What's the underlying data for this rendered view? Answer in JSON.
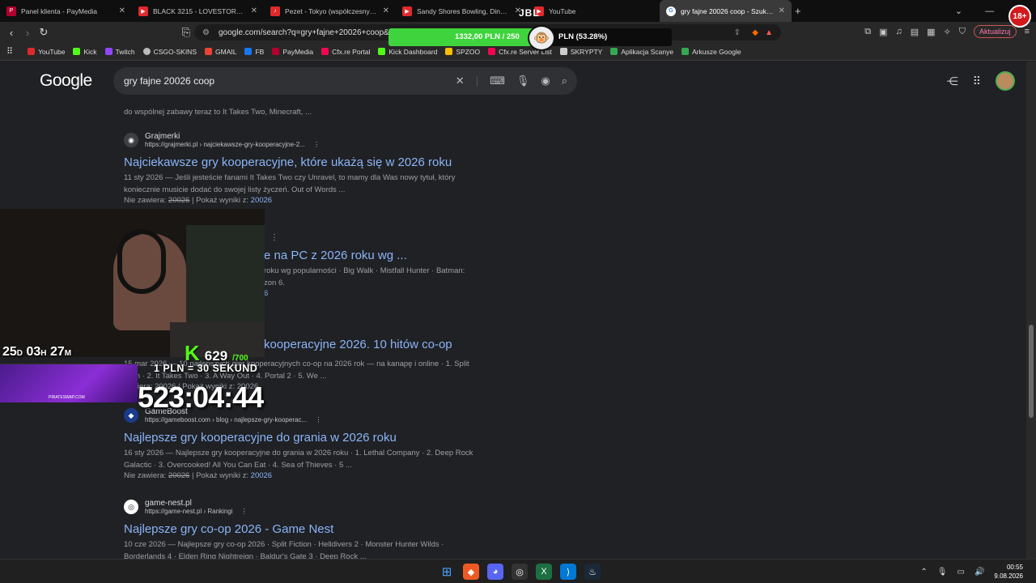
{
  "tabs": [
    {
      "label": "Panel klienta - PayMedia",
      "icon": "paymedia-icon"
    },
    {
      "label": "BLACK 3215 - LOVESTORY - YouTube",
      "icon": "youtube-icon"
    },
    {
      "label": "Pezet - Tokyo (współczesny) (pro",
      "icon": "speaker-icon"
    },
    {
      "label": "Sandy Shores Bowling, Diner & Ste",
      "icon": "youtube-icon"
    },
    {
      "label": "YouTube",
      "icon": "youtube-icon"
    },
    {
      "label": "gry fajne 20026 coop - Szukaj w",
      "icon": "google-icon"
    }
  ],
  "overlay": {
    "jbl": "JBL",
    "donation_text": "1332,00 PLN / 250",
    "donation_text_right": "PLN (53.28%)",
    "donation_percent": 53.28,
    "age_badge": "18+",
    "webcam_timer_days": "25",
    "webcam_timer_hours": "03",
    "webcam_timer_minutes": "27",
    "kick_count": "629",
    "kick_goal": "/700",
    "pln_rate": "1 PLN = 30 SEKUND",
    "big_timer": "523:04:44",
    "purple_caption": "PIRATESWAP.COM"
  },
  "toolbar": {
    "url": "google.com/search?q=gry+fajne+20026+coop&sca_esv=...0tUbHQhPi9o8aQsceEk6Q%3A1786229688127...",
    "update_label": "Aktualizuj"
  },
  "bookmarks": [
    {
      "label": "YouTube",
      "color": "#e0292d"
    },
    {
      "label": "Kick",
      "color": "#53fc18"
    },
    {
      "label": "Twitch",
      "color": "#9146ff"
    },
    {
      "label": "CSGO-SKINS",
      "color": "#bbbbbb"
    },
    {
      "label": "GMAIL",
      "color": "#ea4335"
    },
    {
      "label": "FB",
      "color": "#1877f2"
    },
    {
      "label": "PayMedia",
      "color": "#b3002d"
    },
    {
      "label": "Cfx.re Portal",
      "color": "#f40552"
    },
    {
      "label": "Kick Dashboard",
      "color": "#53fc18"
    },
    {
      "label": "SPZOO",
      "color": "#fbbc04"
    },
    {
      "label": "Cfx.re Server List",
      "color": "#f40552"
    },
    {
      "label": "SKRYPTY",
      "color": "#cccccc"
    },
    {
      "label": "Aplikacja Scanye",
      "color": "#34a853"
    },
    {
      "label": "Arkusze Google",
      "color": "#34a853"
    }
  ],
  "search": {
    "logo": "Google",
    "query": "gry fajne 20026 coop"
  },
  "partial_snippet": "do wspólnej zabawy teraz to It Takes Two, Minecraft, ...",
  "results": [
    {
      "site": "Grajmerki",
      "url": "https://grajmerki.pl › najciekawsze-gry-kooperacyjne-2...",
      "title": "Najciekawsze gry kooperacyjne, które ukażą się w 2026 roku",
      "snippet": "11 sty 2026 — Jeśli jesteście fanami It Takes Two czy Unravel, to mamy dla Was nowy tytuł, który koniecznie musicie dodać do swojej listy życzeń. Out of Words ...",
      "missing_label": "Nie zawiera:",
      "missing_term": "20026",
      "show_label": "| Pokaż wyniki z:",
      "show_term": "20026"
    },
    {
      "title_tail": "e na PC z 2026 roku wg ...",
      "snippet_tail": "roku wg popularności · Big Walk · Mistfall Hunter · Batman:",
      "snippet_tail2": "zon 6.",
      "missing_tail": "6"
    },
    {
      "title_tail": "kooperacyjne 2026. 10 hitów co-op",
      "snippet_tail": "15 mar 2026 — 10 najlepszych gier kooperacyjnych co-op na 2026 rok — na kanapę i online · 1. Split",
      "snippet_tail2": "ction · 2. It Takes Two · 3. A Way Out · 4. Portal 2 · 5. We ...",
      "missing_tail": "zawiera: 20026 | Pokaż wyniki z: 20026"
    },
    {
      "site": "GameBoost",
      "url": "https://gameboost.com › blog › najlepsze-gry-kooperac...",
      "title": "Najlepsze gry kooperacyjne do grania w 2026 roku",
      "snippet": "16 sty 2026 — Najlepsze gry kooperacyjne do grania w 2026 roku · 1. Lethal Company · 2. Deep Rock Galactic · 3. Overcooked! All You Can Eat · 4. Sea of Thieves · 5 ...",
      "missing_label": "Nie zawiera:",
      "missing_term": "20026",
      "show_label": "| Pokaż wyniki z:",
      "show_term": "20026"
    },
    {
      "site": "game-nest.pl",
      "url": "https://game-nest.pl › Rankingi",
      "title": "Najlepsze gry co-op 2026 - Game Nest",
      "snippet": "10 cze 2026 — Najlepsze gry co-op 2026 · Split Fiction · Helldivers 2 · Monster Hunter Wilds · Borderlands 4 · Elden Ring Nightreign · Baldur's Gate 3 · Deep Rock ..."
    }
  ],
  "taskbar": {
    "time": "00:55",
    "date": "9.08.2026"
  }
}
